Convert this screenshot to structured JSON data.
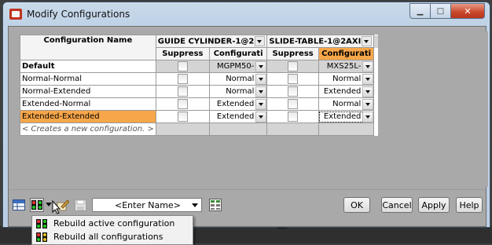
{
  "window": {
    "title": "Modify Configurations"
  },
  "table": {
    "header_config": "Configuration Name",
    "groups": [
      {
        "label": "GUIDE CYLINDER-1@2",
        "col_suppress": "Suppress",
        "col_config": "Configurati"
      },
      {
        "label": "SLIDE-TABLE-1@2AXI",
        "col_suppress": "Suppress",
        "col_config": "Configurati"
      }
    ],
    "rows": [
      {
        "name": "Default",
        "g1_config": "MGPM50-",
        "g2_config": "MXS25L-"
      },
      {
        "name": "Normal-Normal",
        "g1_config": "Normal",
        "g2_config": "Normal"
      },
      {
        "name": "Normal-Extended",
        "g1_config": "Normal",
        "g2_config": "Extended"
      },
      {
        "name": "Extended-Normal",
        "g1_config": "Extended",
        "g2_config": "Normal"
      },
      {
        "name": "Extended-Extended",
        "g1_config": "Extended",
        "g2_config": "Extended"
      }
    ],
    "new_row": "< Creates a new configuration. >"
  },
  "toolbar": {
    "name_combo": "<Enter Name>",
    "ok": "OK",
    "cancel": "Cancel",
    "apply": "Apply",
    "help": "Help"
  },
  "menu": {
    "items": [
      {
        "label": "Rebuild active configuration",
        "icon": "rebuild-active-icon"
      },
      {
        "label": "Rebuild all configurations",
        "icon": "rebuild-all-icon"
      }
    ]
  },
  "colors": {
    "selection": "#f7a64a",
    "client_bg": "#a9a9a9",
    "title_bar": "#c9d9ea"
  }
}
